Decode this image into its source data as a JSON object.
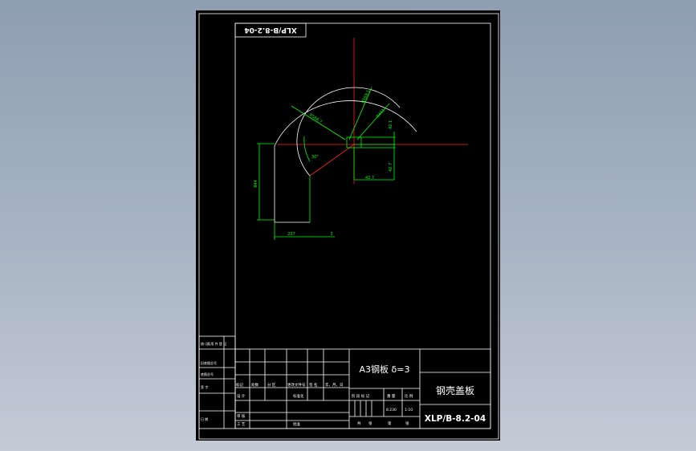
{
  "drawing": {
    "code": "XLP/B-8.2-04",
    "code_rotated": "XLP/B-8.2-04",
    "part_name": "钢壳盖板",
    "material": "A3钢板 δ=3",
    "scale": "1:10",
    "weight": "8.230"
  },
  "dimensions": {
    "r_outer": "R586.7",
    "r_mid": "R559.1",
    "r_inner": "R411",
    "angle": "30°",
    "height": "844",
    "width": "237",
    "thickness": "3",
    "d1": "42.1",
    "d2": "42.7",
    "d3": "42.7"
  },
  "title_block": {
    "left_labels": [
      "借 (通)用 件 登 记",
      "旧底图总号",
      "底图总号",
      "签 字",
      "日 期"
    ],
    "rev_headers": [
      "标记",
      "处数",
      "分 区",
      "更改文件号",
      "签 名",
      "年、月、日"
    ],
    "roles": [
      "设 计",
      "审 核",
      "工 艺"
    ],
    "std_label": "标准化",
    "approve_label": "批准",
    "stage_labels": [
      "阶 段 标 记",
      "重 量",
      "比 例"
    ],
    "sheet_labels": [
      "共",
      "张",
      "第",
      "张"
    ]
  },
  "colors": {
    "background": "#000000",
    "frame": "#ffffff",
    "dimension": "#00ff00",
    "centerline": "#ff2020"
  }
}
